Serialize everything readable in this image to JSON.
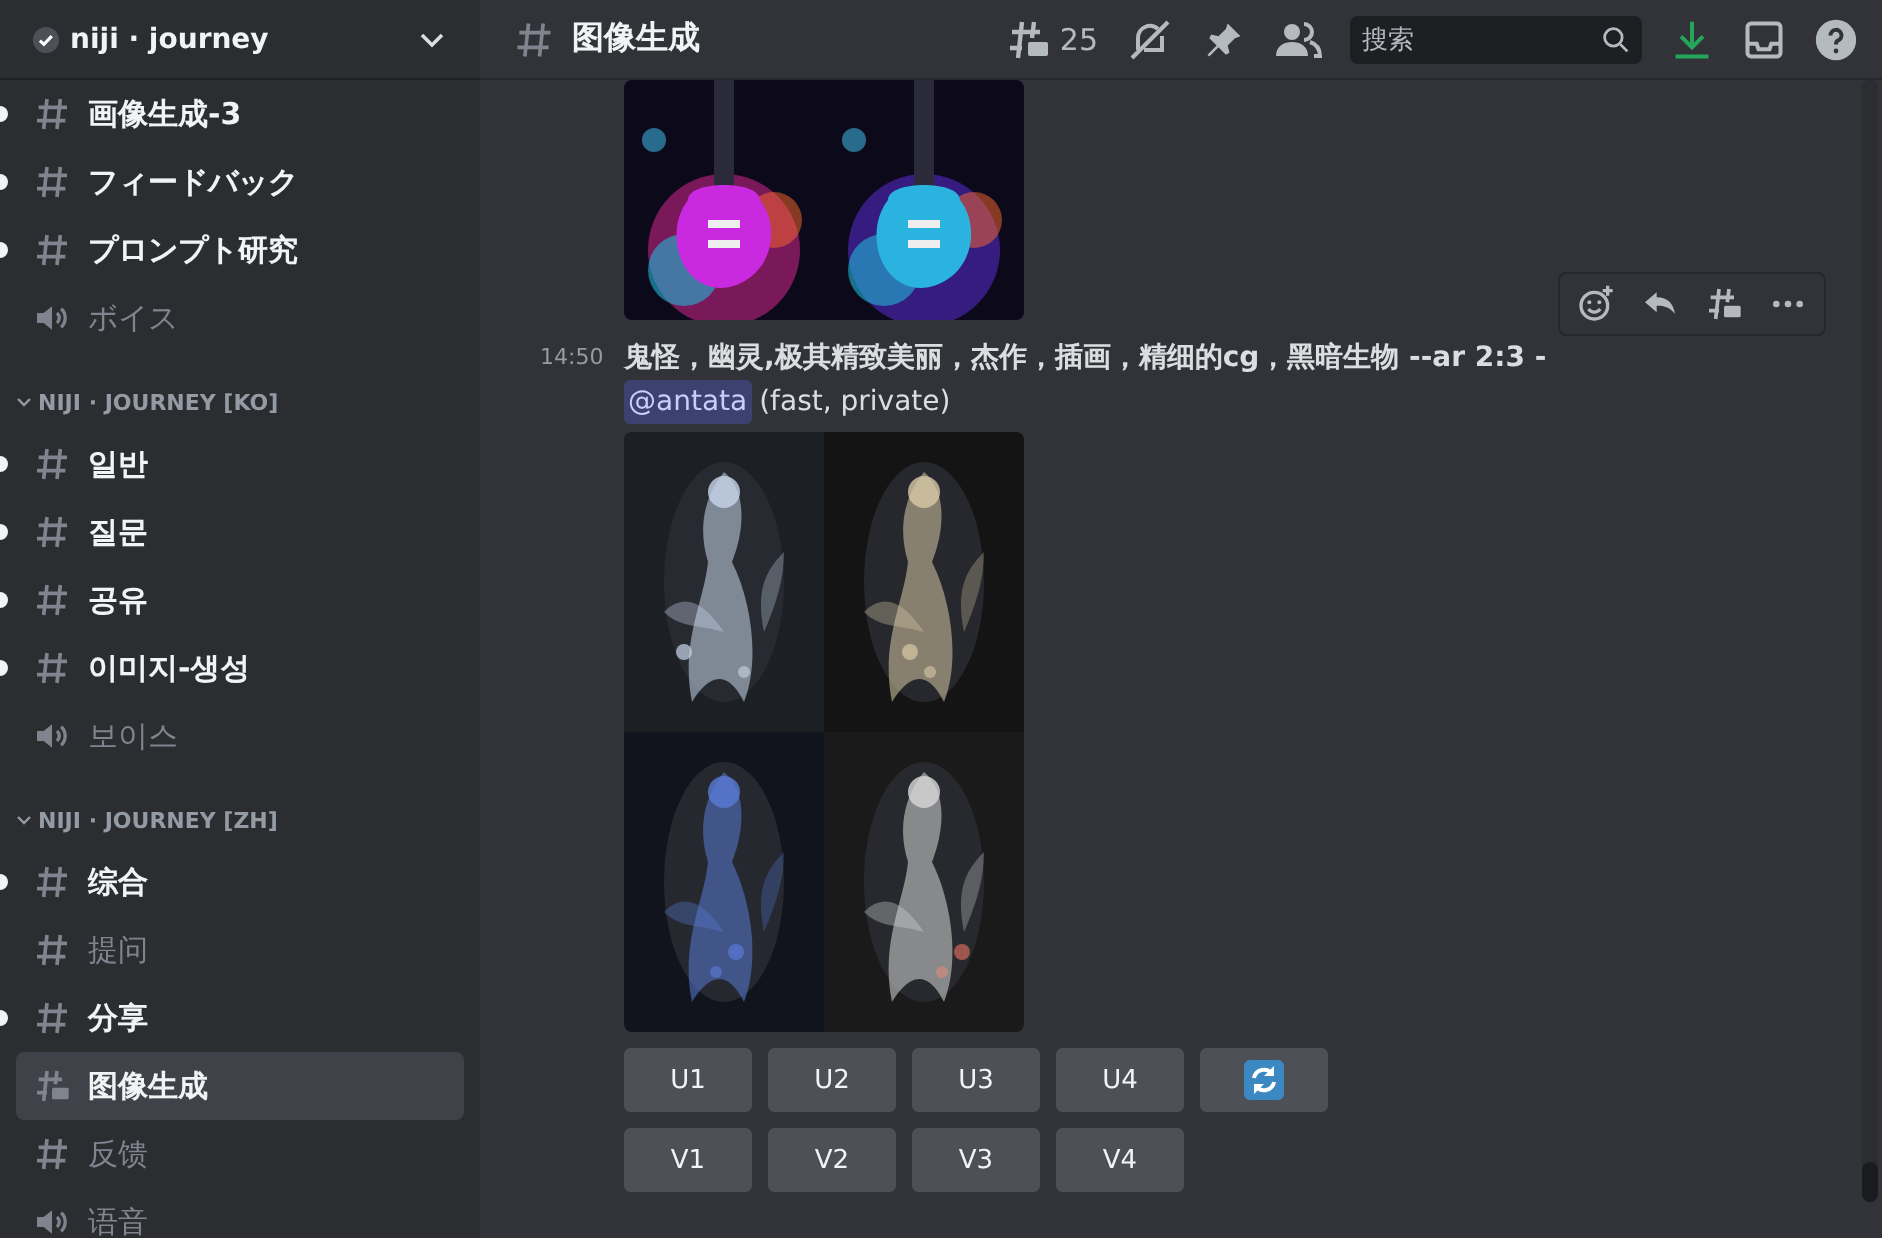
{
  "server": {
    "name": "niji · journey",
    "verified": true
  },
  "sidebar": {
    "sections": [
      {
        "items": [
          {
            "label": "画像生成-3",
            "kind": "text",
            "unread": true,
            "selected": false
          },
          {
            "label": "フィードバック",
            "kind": "text",
            "unread": true,
            "selected": false
          },
          {
            "label": "プロンプト研究",
            "kind": "text",
            "unread": true,
            "selected": false
          },
          {
            "label": "ボイス",
            "kind": "voice",
            "unread": false,
            "selected": false
          }
        ]
      },
      {
        "category": "NIJI · JOURNEY [KO]",
        "items": [
          {
            "label": "일반",
            "kind": "text",
            "unread": true,
            "selected": false
          },
          {
            "label": "질문",
            "kind": "text",
            "unread": true,
            "selected": false
          },
          {
            "label": "공유",
            "kind": "text",
            "unread": true,
            "selected": false
          },
          {
            "label": "이미지-생성",
            "kind": "text",
            "unread": true,
            "selected": false
          },
          {
            "label": "보이스",
            "kind": "voice",
            "unread": false,
            "selected": false
          }
        ]
      },
      {
        "category": "NIJI · JOURNEY [ZH]",
        "items": [
          {
            "label": "综合",
            "kind": "text",
            "unread": true,
            "selected": false
          },
          {
            "label": "提问",
            "kind": "text",
            "unread": false,
            "selected": false
          },
          {
            "label": "分享",
            "kind": "text",
            "unread": true,
            "selected": false
          },
          {
            "label": "图像生成",
            "kind": "forum",
            "unread": false,
            "selected": true
          },
          {
            "label": "反馈",
            "kind": "text",
            "unread": false,
            "selected": false
          },
          {
            "label": "语音",
            "kind": "voice",
            "unread": false,
            "selected": false
          }
        ]
      }
    ]
  },
  "header": {
    "channel": "图像生成",
    "threads": "25",
    "search": {
      "placeholder": "搜索"
    }
  },
  "messages": [
    {
      "time": "14:50",
      "prompt": "鬼怪，幽灵,极其精致美丽，杰作，插画，精细的cg，黑暗生物 --ar 2:3 -",
      "mention": "@antata",
      "note": "(fast, private)",
      "buttons": [
        [
          {
            "label": "U1",
            "kind": "text"
          },
          {
            "label": "U2",
            "kind": "text"
          },
          {
            "label": "U3",
            "kind": "text"
          },
          {
            "label": "U4",
            "kind": "text"
          },
          {
            "kind": "reroll"
          }
        ],
        [
          {
            "label": "V1",
            "kind": "text"
          },
          {
            "label": "V2",
            "kind": "text"
          },
          {
            "label": "V3",
            "kind": "text"
          },
          {
            "label": "V4",
            "kind": "text"
          }
        ]
      ]
    }
  ]
}
